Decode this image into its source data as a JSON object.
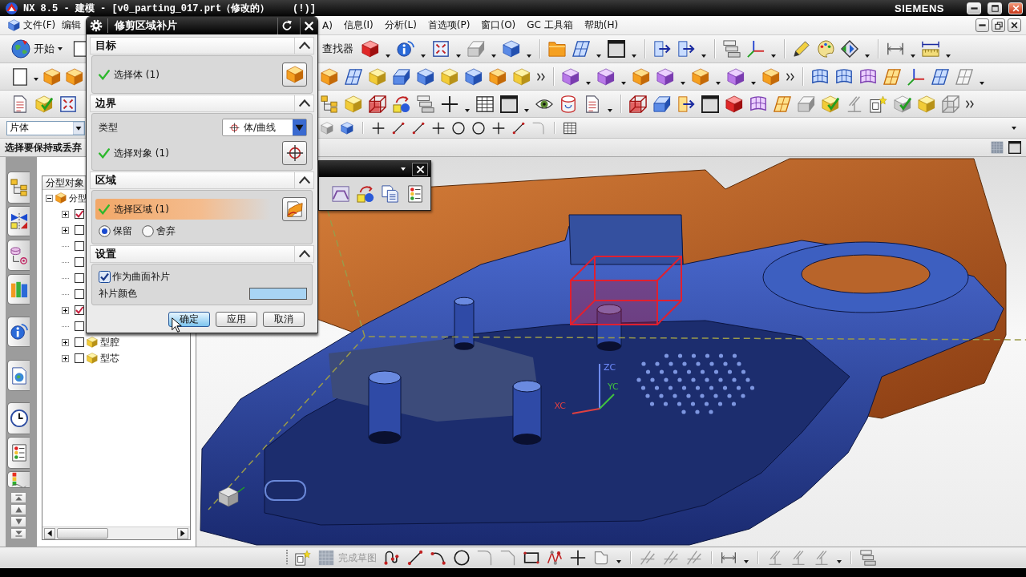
{
  "window": {
    "title": "NX 8.5 - 建模 - [v0_parting_017.prt（修改的）    (!)]",
    "brand": "SIEMENS"
  },
  "menu": {
    "left": [
      {
        "label": "文件(F)"
      },
      {
        "label": "编辑"
      }
    ],
    "right": [
      {
        "label": "A)"
      },
      {
        "label": "信息(I)"
      },
      {
        "label": "分析(L)"
      },
      {
        "label": "首选项(P)"
      },
      {
        "label": "窗口(O)"
      },
      {
        "label": "GC 工具箱"
      },
      {
        "label": "帮助(H)"
      }
    ]
  },
  "toolbar": {
    "start_button": "开始",
    "finder_button": "查找器",
    "selection_filter": "片体"
  },
  "cue_line": "选择要保持或丢弃",
  "navigator": {
    "header": "分型对象",
    "root": {
      "label": "分型",
      "expanded": true,
      "children": [
        {
          "kind": "group",
          "checked": true
        },
        {
          "kind": "group",
          "checked": false
        },
        {
          "kind": "leaf",
          "checked": false
        },
        {
          "kind": "leaf",
          "checked": false
        },
        {
          "kind": "leaf",
          "checked": false
        },
        {
          "kind": "leaf",
          "checked": false
        },
        {
          "kind": "group",
          "checked": true
        },
        {
          "kind": "leaf",
          "checked": false
        },
        {
          "kind": "group",
          "checked": false,
          "label": "型腔"
        },
        {
          "kind": "group",
          "checked": false,
          "label": "型芯"
        }
      ]
    }
  },
  "dialog": {
    "title": "修剪区域补片",
    "sections": [
      {
        "title": "目标",
        "expanded": true,
        "rows": [
          {
            "kind": "selection",
            "label": "选择体 (1)",
            "complete": true,
            "active": false
          }
        ]
      },
      {
        "title": "边界",
        "expanded": true,
        "rows": [
          {
            "kind": "dropdown",
            "label": "类型",
            "value": "体/曲线"
          },
          {
            "kind": "selection",
            "label": "选择对象 (1)",
            "complete": true,
            "active": false
          }
        ]
      },
      {
        "title": "区域",
        "expanded": true,
        "rows": [
          {
            "kind": "selection",
            "label": "选择区域 (1)",
            "complete": true,
            "active": true
          },
          {
            "kind": "radio",
            "options": [
              {
                "label": "保留",
                "selected": true
              },
              {
                "label": "舍弃",
                "selected": false
              }
            ]
          }
        ]
      },
      {
        "title": "设置",
        "expanded": true,
        "rows": [
          {
            "kind": "checkbox",
            "label": "作为曲面补片",
            "checked": true
          },
          {
            "kind": "color",
            "label": "补片颜色",
            "color": "#a8d4f4"
          }
        ]
      }
    ],
    "buttons": [
      {
        "label": "确定",
        "default": true
      },
      {
        "label": "应用",
        "default": false
      },
      {
        "label": "取消",
        "default": false
      }
    ]
  },
  "viewport": {
    "axis_labels": [
      {
        "label": "ZC",
        "color": "#6f8cff"
      },
      {
        "label": "YC",
        "color": "#40c040"
      },
      {
        "label": "XC",
        "color": "#e04040"
      }
    ]
  },
  "sketch_toolbar": {
    "finish_sketch": {
      "label": "完成草图",
      "disabled": true
    }
  }
}
